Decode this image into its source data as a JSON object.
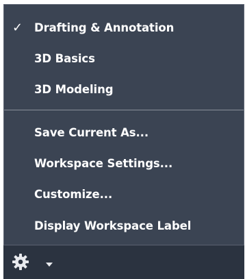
{
  "menu": {
    "checkmark": "✓",
    "items": [
      {
        "label": "Drafting & Annotation",
        "checked": true
      },
      {
        "label": "3D Basics"
      },
      {
        "label": "3D Modeling"
      },
      {
        "label": "Save Current As..."
      },
      {
        "label": "Workspace Settings..."
      },
      {
        "label": "Customize..."
      },
      {
        "label": "Display Workspace Label"
      }
    ]
  },
  "statusbar": {
    "icons": [
      "gear-icon",
      "chevron-down-icon"
    ]
  },
  "colors": {
    "menu_bg": "#3b4453",
    "statusbar_bg": "#2b3340",
    "text": "#ffffff",
    "divider": "#8a909a"
  }
}
